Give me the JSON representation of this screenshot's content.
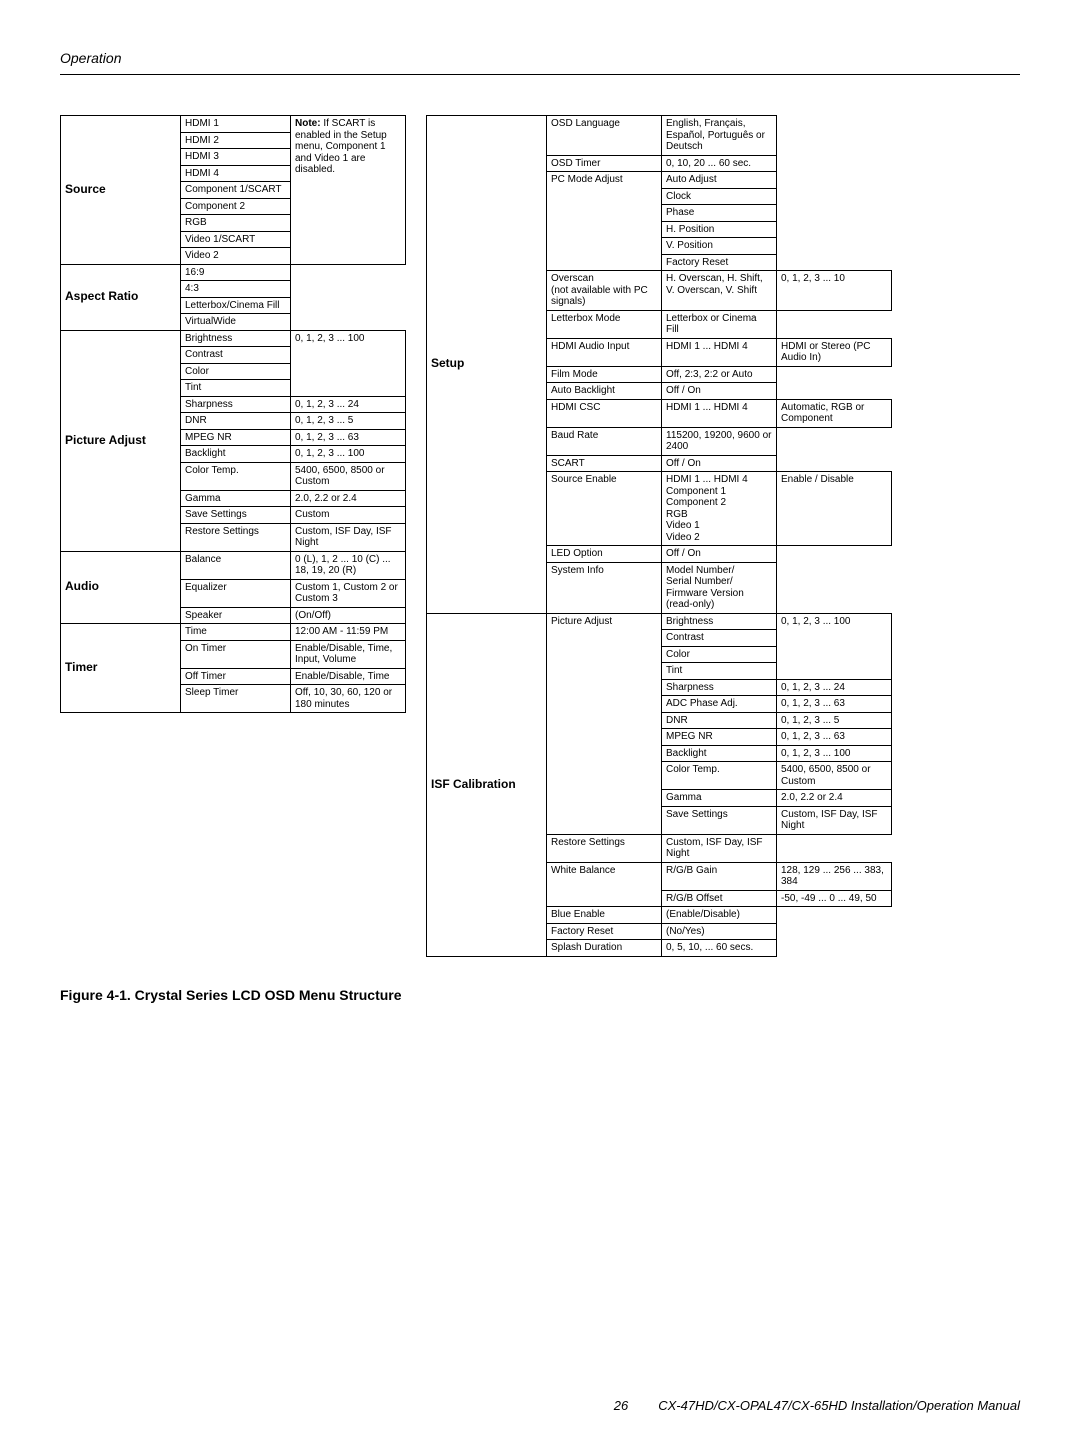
{
  "header": "Operation",
  "footer": {
    "page": "26",
    "manual": "CX-47HD/CX-OPAL47/CX-65HD Installation/Operation Manual"
  },
  "caption": "Figure 4-1. Crystal Series LCD OSD Menu Structure",
  "left": [
    {
      "name": "Source",
      "note_col": {
        "span": 10,
        "text_prefix": "Note:",
        "text": " If SCART is enabled in the Setup menu, Component 1 and Video 1 are disabled."
      },
      "rows": [
        {
          "item": "HDMI 1"
        },
        {
          "item": "HDMI 2"
        },
        {
          "item": "HDMI 3"
        },
        {
          "item": "HDMI 4"
        },
        {
          "item": "Component 1/SCART"
        },
        {
          "item": "Component 2"
        },
        {
          "item": "RGB"
        },
        {
          "item": "Video 1/SCART"
        },
        {
          "item": "Video 2"
        }
      ]
    },
    {
      "name": "Aspect Ratio",
      "rows": [
        {
          "item": "16:9"
        },
        {
          "item": "4:3"
        },
        {
          "item": "Letterbox/Cinema Fill"
        },
        {
          "item": "VirtualWide"
        }
      ]
    },
    {
      "name": "Picture Adjust",
      "rows": [
        {
          "item": "Brightness",
          "val_span": 4,
          "val": "0, 1, 2, 3 ... 100"
        },
        {
          "item": "Contrast"
        },
        {
          "item": "Color"
        },
        {
          "item": "Tint"
        },
        {
          "item": "Sharpness",
          "val": "0, 1, 2, 3 ... 24"
        },
        {
          "item": "DNR",
          "val": "0, 1, 2, 3 ... 5"
        },
        {
          "item": "MPEG NR",
          "val": "0, 1, 2, 3 ... 63"
        },
        {
          "item": "Backlight",
          "val": "0, 1, 2, 3 ... 100"
        },
        {
          "item": "Color Temp.",
          "val": "5400, 6500, 8500 or Custom"
        },
        {
          "item": "Gamma",
          "val": "2.0, 2.2 or 2.4"
        },
        {
          "item": "Save Settings",
          "val": "Custom"
        },
        {
          "item": "Restore Settings",
          "val": "Custom, ISF Day, ISF Night"
        }
      ]
    },
    {
      "name": "Audio",
      "rows": [
        {
          "item": "Balance",
          "val": "0 (L), 1, 2 ... 10 (C) ... 18, 19, 20 (R)"
        },
        {
          "item": "Equalizer",
          "val": "Custom 1, Custom 2 or Custom 3"
        },
        {
          "item": "Speaker",
          "val": "(On/Off)"
        }
      ]
    },
    {
      "name": "Timer",
      "rows": [
        {
          "item": "Time",
          "val": "12:00 AM - 11:59 PM"
        },
        {
          "item": "On Timer",
          "val": "Enable/Disable, Time, Input, Volume"
        },
        {
          "item": "Off Timer",
          "val": "Enable/Disable, Time"
        },
        {
          "item": "Sleep Timer",
          "val": "Off, 10, 30, 60, 120 or 180 minutes"
        }
      ]
    }
  ],
  "right": [
    {
      "name": "Setup",
      "rows": [
        {
          "item": "OSD Language",
          "val": "English, Français, Español, Português or Deutsch"
        },
        {
          "item": "OSD Timer",
          "val": "0, 10, 20 ... 60 sec."
        },
        {
          "item": "PC Mode Adjust",
          "item_span": 6,
          "val": "Auto Adjust"
        },
        {
          "val": "Clock"
        },
        {
          "val": "Phase"
        },
        {
          "val": "H. Position"
        },
        {
          "val": "V. Position"
        },
        {
          "val": "Factory Reset"
        },
        {
          "item": "Overscan\n(not available with PC signals)",
          "val": "H. Overscan, H. Shift, V. Overscan, V. Shift",
          "val2": "0, 1, 2, 3 ... 10"
        },
        {
          "item": "Letterbox Mode",
          "val": "Letterbox or Cinema Fill"
        },
        {
          "item": "HDMI Audio Input",
          "val": "HDMI 1 ... HDMI 4",
          "val2": "HDMI or Stereo (PC Audio In)"
        },
        {
          "item": "Film Mode",
          "val": "Off, 2:3, 2:2 or Auto"
        },
        {
          "item": "Auto Backlight",
          "val": "Off / On"
        },
        {
          "item": "HDMI CSC",
          "val": "HDMI 1 ... HDMI 4",
          "val2": "Automatic, RGB or Component"
        },
        {
          "item": "Baud Rate",
          "val": "115200, 19200, 9600 or 2400"
        },
        {
          "item": "SCART",
          "val": "Off / On"
        },
        {
          "item": "Source Enable",
          "val": "HDMI 1 ... HDMI 4\nComponent 1\nComponent 2\nRGB\nVideo 1\nVideo 2",
          "val2": "Enable / Disable"
        },
        {
          "item": "LED Option",
          "val": "Off / On"
        },
        {
          "item": "System Info",
          "val": "Model Number/\nSerial Number/\nFirmware Version\n(read-only)"
        }
      ]
    },
    {
      "name": "ISF Calibration",
      "rows": [
        {
          "item": "Picture Adjust",
          "item_span": 12,
          "val": "Brightness",
          "val2_span": 4,
          "val2": "0, 1, 2, 3 ... 100"
        },
        {
          "val": "Contrast"
        },
        {
          "val": "Color"
        },
        {
          "val": "Tint"
        },
        {
          "val": "Sharpness",
          "val2": "0, 1, 2, 3 ... 24"
        },
        {
          "val": "ADC Phase Adj.",
          "val2": "0, 1, 2, 3 ... 63"
        },
        {
          "val": "DNR",
          "val2": "0, 1, 2, 3 ... 5"
        },
        {
          "val": "MPEG NR",
          "val2": "0, 1, 2, 3 ... 63"
        },
        {
          "val": "Backlight",
          "val2": "0, 1, 2, 3 ... 100"
        },
        {
          "val": "Color Temp.",
          "val2": "5400, 6500, 8500 or Custom"
        },
        {
          "val": "Gamma",
          "val2": "2.0, 2.2 or 2.4"
        },
        {
          "val": "Save Settings",
          "val2": "Custom, ISF Day, ISF Night"
        },
        {
          "val": "Restore Settings",
          "val2": "Custom, ISF Day, ISF Night",
          "item_end": true
        },
        {
          "item": "White Balance",
          "item_span": 2,
          "val": "R/G/B Gain",
          "val2": "128, 129 ... 256 ... 383, 384"
        },
        {
          "val": "R/G/B Offset",
          "val2": "-50, -49 ... 0 ... 49, 50"
        },
        {
          "item": "Blue Enable",
          "val": "(Enable/Disable)"
        },
        {
          "item": "Factory Reset",
          "val": "(No/Yes)"
        },
        {
          "item": "Splash Duration",
          "val": "0, 5, 10, ... 60 secs."
        }
      ]
    }
  ]
}
